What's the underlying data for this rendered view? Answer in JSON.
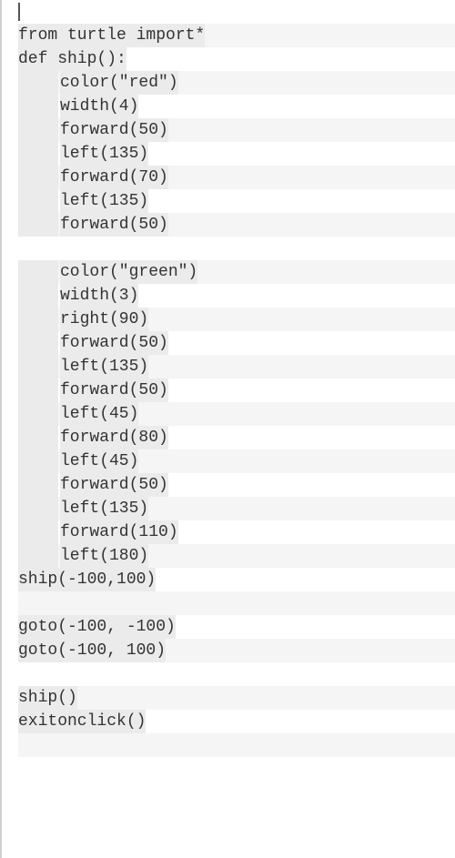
{
  "code": {
    "lines": [
      {
        "indent": 0,
        "text": "",
        "cursor": true
      },
      {
        "indent": 0,
        "text": "from turtle import*"
      },
      {
        "indent": 0,
        "text": "def ship():"
      },
      {
        "indent": 1,
        "text": "color(\"red\")"
      },
      {
        "indent": 1,
        "text": "width(4)"
      },
      {
        "indent": 1,
        "text": "forward(50)"
      },
      {
        "indent": 1,
        "text": "left(135)"
      },
      {
        "indent": 1,
        "text": "forward(70)"
      },
      {
        "indent": 1,
        "text": "left(135)"
      },
      {
        "indent": 1,
        "text": "forward(50)"
      },
      {
        "indent": 0,
        "text": ""
      },
      {
        "indent": 1,
        "text": "color(\"green\")"
      },
      {
        "indent": 1,
        "text": "width(3)"
      },
      {
        "indent": 1,
        "text": "right(90)"
      },
      {
        "indent": 1,
        "text": "forward(50)"
      },
      {
        "indent": 1,
        "text": "left(135)"
      },
      {
        "indent": 1,
        "text": "forward(50)"
      },
      {
        "indent": 1,
        "text": "left(45)"
      },
      {
        "indent": 1,
        "text": "forward(80)"
      },
      {
        "indent": 1,
        "text": "left(45)"
      },
      {
        "indent": 1,
        "text": "forward(50)"
      },
      {
        "indent": 1,
        "text": "left(135)"
      },
      {
        "indent": 1,
        "text": "forward(110)"
      },
      {
        "indent": 1,
        "text": "left(180)"
      },
      {
        "indent": 0,
        "text": "ship(-100,100)"
      },
      {
        "indent": 0,
        "text": ""
      },
      {
        "indent": 0,
        "text": "goto(-100, -100)"
      },
      {
        "indent": 0,
        "text": "goto(-100, 100)"
      },
      {
        "indent": 0,
        "text": ""
      },
      {
        "indent": 0,
        "text": "ship()"
      },
      {
        "indent": 0,
        "text": "exitonclick()"
      },
      {
        "indent": 0,
        "text": ""
      }
    ]
  }
}
